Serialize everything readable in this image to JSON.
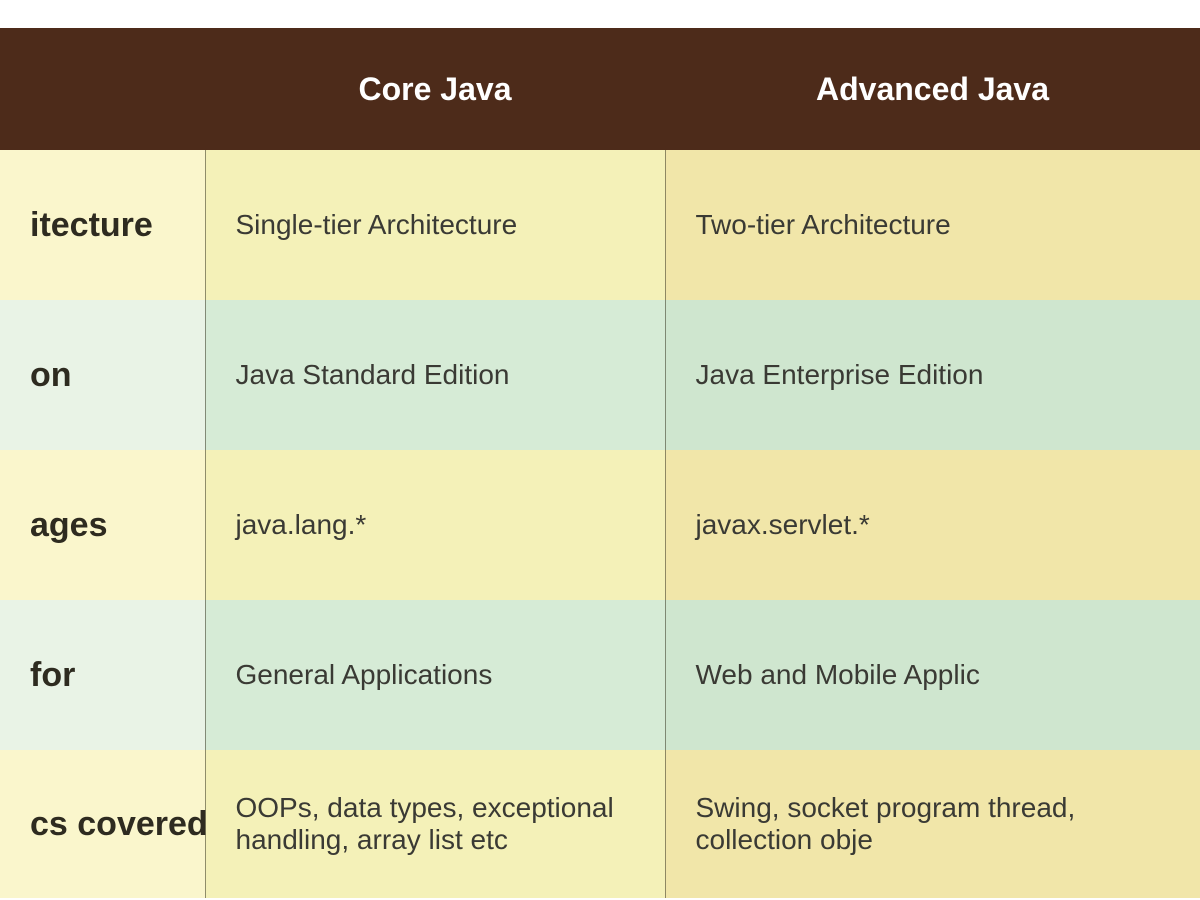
{
  "headers": {
    "col0": "",
    "col1": "Core Java",
    "col2": "Advanced Java"
  },
  "rows": [
    {
      "label": "itecture",
      "core": "Single-tier Architecture",
      "advanced": "Two-tier Architecture"
    },
    {
      "label": "on",
      "core": "Java Standard Edition",
      "advanced": "Java Enterprise Edition"
    },
    {
      "label": "ages",
      "core": "java.lang.*",
      "advanced": "javax.servlet.*"
    },
    {
      "label": "for",
      "core": "General Applications",
      "advanced": "Web and Mobile Applic"
    },
    {
      "label": "cs covered",
      "core": "OOPs, data types, exceptional handling, array list etc",
      "advanced": "Swing, socket program thread, collection obje"
    }
  ]
}
